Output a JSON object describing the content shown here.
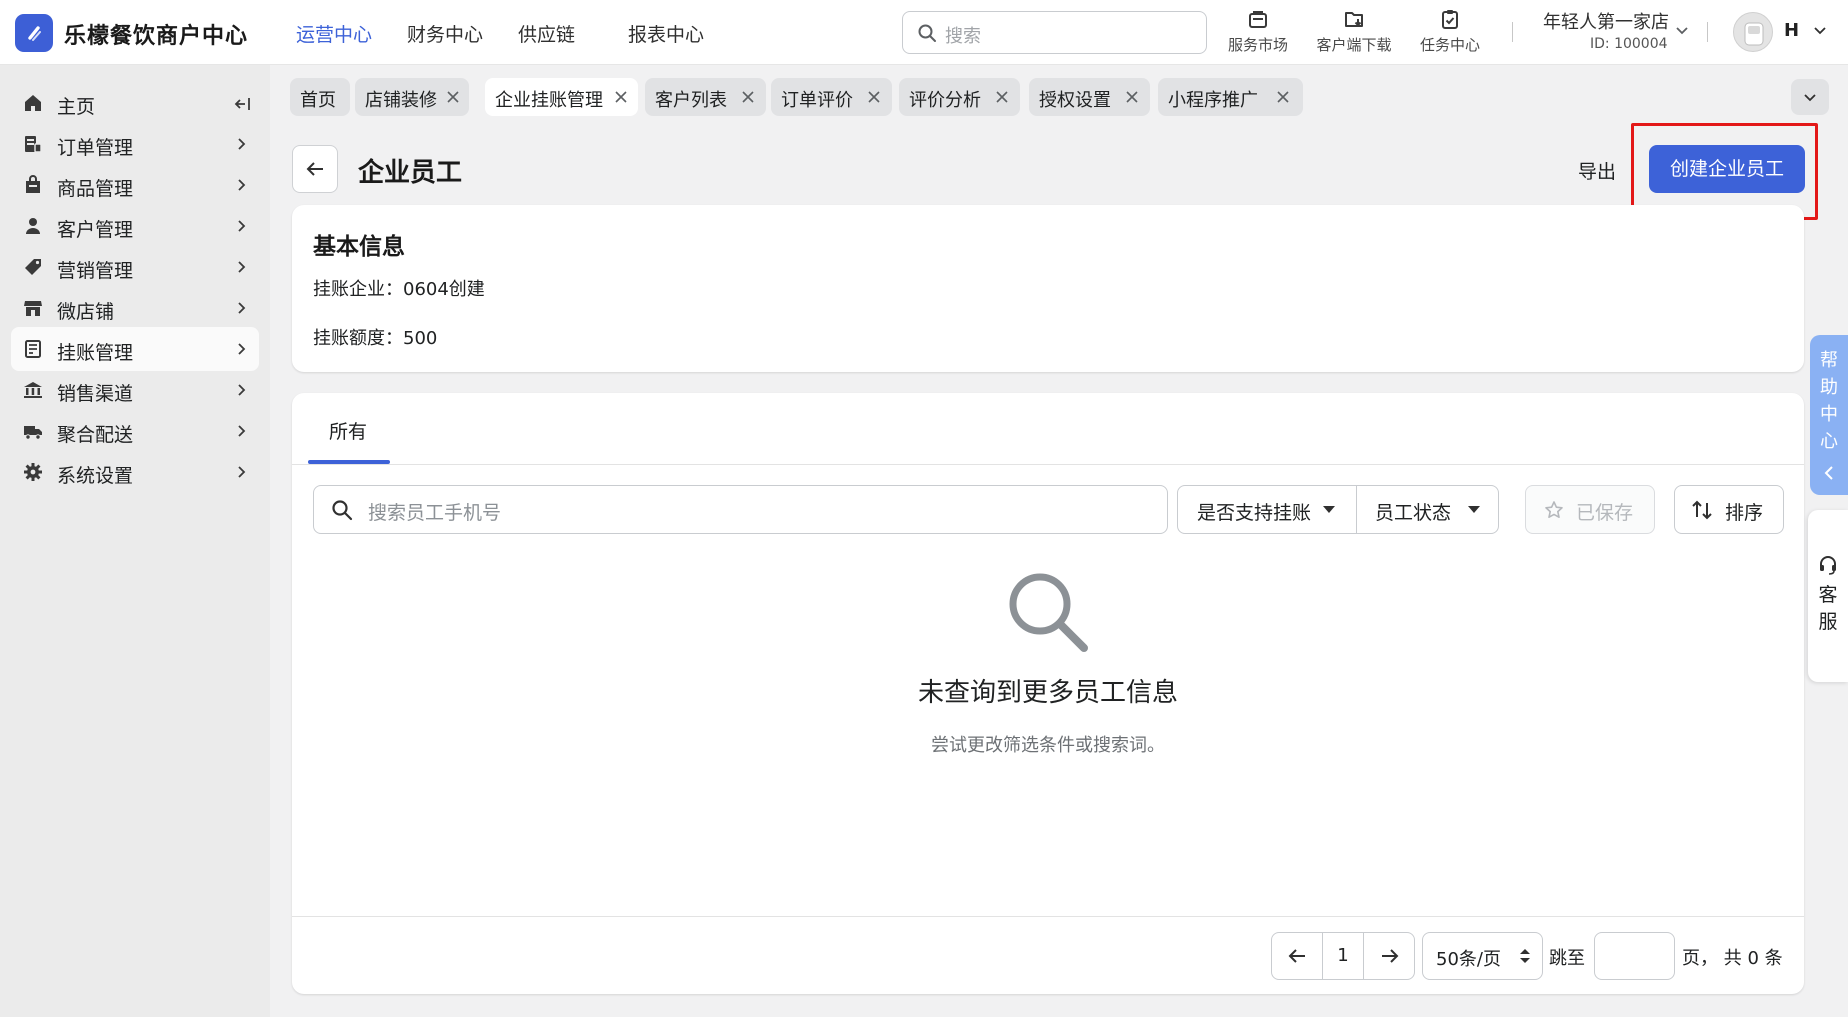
{
  "app": {
    "brand": "乐檬餐饮商户中心",
    "accent_color": "#3d62d8"
  },
  "top_nav": [
    {
      "label": "运营中心",
      "active": true
    },
    {
      "label": "财务中心",
      "active": false
    },
    {
      "label": "供应链",
      "active": false
    },
    {
      "label": "报表中心",
      "active": false
    }
  ],
  "search": {
    "placeholder": "搜索"
  },
  "tools": [
    {
      "label": "服务市场",
      "icon": "store-bag-icon"
    },
    {
      "label": "客户端下载",
      "icon": "folder-download-icon"
    },
    {
      "label": "任务中心",
      "icon": "clipboard-check-icon"
    }
  ],
  "store": {
    "name": "年轻人第一家店",
    "id": "ID: 100004"
  },
  "user": {
    "initial": "H"
  },
  "sidebar": {
    "items": [
      {
        "label": "主页",
        "icon": "home-icon"
      },
      {
        "label": "订单管理",
        "icon": "order-icon"
      },
      {
        "label": "商品管理",
        "icon": "product-icon"
      },
      {
        "label": "客户管理",
        "icon": "customer-icon"
      },
      {
        "label": "营销管理",
        "icon": "tag-icon"
      },
      {
        "label": "微店铺",
        "icon": "shop-icon"
      },
      {
        "label": "挂账管理",
        "icon": "ledger-icon"
      },
      {
        "label": "销售渠道",
        "icon": "channel-icon"
      },
      {
        "label": "聚合配送",
        "icon": "delivery-truck-icon"
      },
      {
        "label": "系统设置",
        "icon": "settings-gear-icon"
      }
    ]
  },
  "tabs": [
    {
      "label": "首页",
      "closable": false
    },
    {
      "label": "店铺装修",
      "closable": true
    },
    {
      "label": "企业挂账管理",
      "closable": true,
      "active": true
    },
    {
      "label": "客户列表",
      "closable": true
    },
    {
      "label": "订单评价",
      "closable": true
    },
    {
      "label": "评价分析",
      "closable": true
    },
    {
      "label": "授权设置",
      "closable": true
    },
    {
      "label": "小程序推广",
      "closable": true
    }
  ],
  "page": {
    "title": "企业员工",
    "export_label": "导出",
    "create_label": "创建企业员工"
  },
  "basic_info": {
    "heading": "基本信息",
    "company_label": "挂账企业：",
    "company_value": "0604创建",
    "limit_label": "挂账额度：",
    "limit_value": "500"
  },
  "list": {
    "tab_all": "所有",
    "search_placeholder": "搜索员工手机号",
    "filter_credit": "是否支持挂账",
    "filter_status": "员工状态",
    "saved_label": "已保存",
    "sort_label": "排序",
    "empty_title": "未查询到更多员工信息",
    "empty_sub": "尝试更改筛选条件或搜索词。"
  },
  "pagination": {
    "page": "1",
    "per_page": "50条/页",
    "jump_label": "跳至",
    "total_label": "页，  共 0 条"
  },
  "floating": {
    "help": "帮助中心",
    "service": "客服"
  }
}
